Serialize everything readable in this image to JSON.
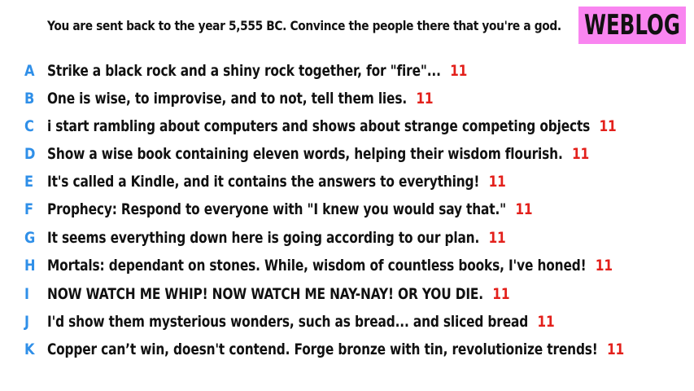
{
  "question": "You are sent back to the year 5,555 BC. Convince the people there that you're a god.",
  "badge": "WEBLOG",
  "colors": {
    "letter": "#2f8fe8",
    "count": "#e3201b",
    "badge_bg": "#f985f0"
  },
  "answers": [
    {
      "letter": "A",
      "text": "Strike a black rock and a shiny rock together, for \"fire\"...",
      "count": "11"
    },
    {
      "letter": "B",
      "text": "One is wise, to improvise, and to not, tell them lies.",
      "count": "11"
    },
    {
      "letter": "C",
      "text": "i start rambling about computers and shows about strange competing objects",
      "count": "11"
    },
    {
      "letter": "D",
      "text": "Show a wise book containing eleven words, helping their wisdom flourish.",
      "count": "11"
    },
    {
      "letter": "E",
      "text": "It's called a Kindle, and it contains the answers to everything!",
      "count": "11"
    },
    {
      "letter": "F",
      "text": "Prophecy: Respond to everyone with \"I knew you would say that.\"",
      "count": "11"
    },
    {
      "letter": "G",
      "text": "It seems everything down here is going according to our plan.",
      "count": "11"
    },
    {
      "letter": "H",
      "text": "Mortals: dependant on stones. While, wisdom of countless books, I've honed!",
      "count": "11"
    },
    {
      "letter": "I",
      "text": "NOW WATCH ME WHIP! NOW WATCH ME NAY-NAY! OR YOU DIE.",
      "count": "11"
    },
    {
      "letter": "J",
      "text": "I'd show them mysterious wonders, such as bread... and sliced bread",
      "count": "11"
    },
    {
      "letter": "K",
      "text": "Copper can’t win, doesn't contend. Forge bronze with tin, revolutionize trends!",
      "count": "11"
    }
  ]
}
